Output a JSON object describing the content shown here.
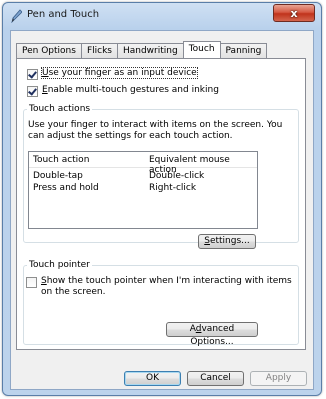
{
  "window": {
    "title": "Pen and Touch",
    "close_label": "x"
  },
  "tabs": [
    {
      "label": "Pen Options",
      "active": false
    },
    {
      "label": "Flicks",
      "active": false
    },
    {
      "label": "Handwriting",
      "active": false
    },
    {
      "label": "Touch",
      "active": true
    },
    {
      "label": "Panning",
      "active": false
    }
  ],
  "options": {
    "use_finger": {
      "pre": "",
      "key": "U",
      "post": "se your finger as an input device",
      "checked": true
    },
    "multitouch": {
      "pre": "",
      "key": "E",
      "post": "nable multi-touch gestures and inking",
      "checked": true
    }
  },
  "touch_actions": {
    "title": "Touch actions",
    "description_line1": "Use your finger to interact with items on the screen. You",
    "description_line2": "can adjust the settings for each touch action.",
    "columns": [
      "Touch action",
      "Equivalent mouse action"
    ],
    "rows": [
      [
        "Double-tap",
        "Double-click"
      ],
      [
        "Press and hold",
        "Right-click"
      ]
    ],
    "settings_button": {
      "pre": "",
      "key": "S",
      "post": "ettings..."
    }
  },
  "touch_pointer": {
    "title": "Touch pointer",
    "checkbox": {
      "line1_pre": "",
      "line1_key": "S",
      "line1_post": "how the touch pointer when I'm interacting with items",
      "line2": "on the screen.",
      "checked": false
    },
    "advanced_button": {
      "pre": "A",
      "key": "d",
      "post": "vanced Options..."
    }
  },
  "footer": {
    "ok": "OK",
    "cancel": "Cancel",
    "apply": "Apply"
  }
}
